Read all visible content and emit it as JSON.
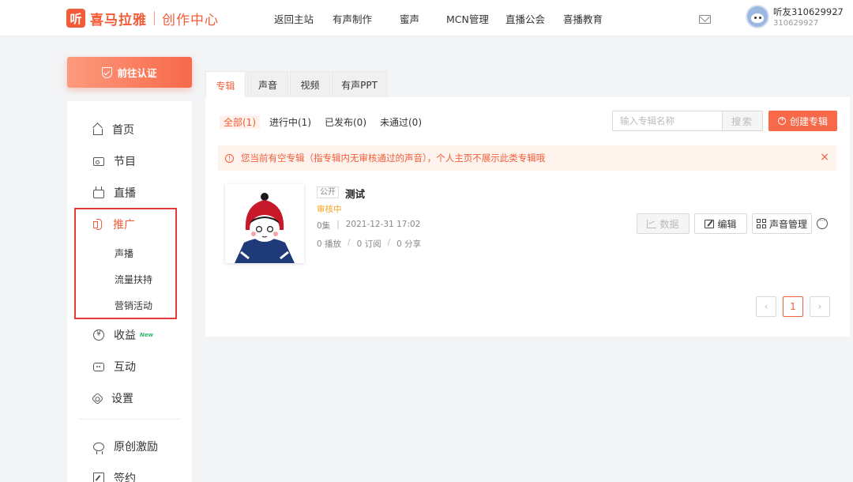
{
  "header": {
    "logo_mark": "听",
    "logo_name": "喜马拉雅",
    "logo_sub": "创作中心",
    "nav": [
      "返回主站",
      "有声制作",
      "蜜声",
      "MCN管理",
      "直播公会",
      "喜播教育"
    ],
    "user_name": "听友310629927",
    "user_id": "310629927"
  },
  "sidebar": {
    "certify_label": "前往认证",
    "items": [
      {
        "label": "首页",
        "icon": "home-icon"
      },
      {
        "label": "节目",
        "icon": "radio-icon"
      },
      {
        "label": "直播",
        "icon": "tv-icon"
      },
      {
        "label": "推广",
        "icon": "speaker-icon"
      },
      {
        "label": "收益",
        "icon": "coin-icon",
        "badge": "New"
      },
      {
        "label": "互动",
        "icon": "chat-icon"
      },
      {
        "label": "设置",
        "icon": "gear-icon"
      },
      {
        "label": "原创激励",
        "icon": "medal-icon"
      },
      {
        "label": "签约",
        "icon": "sign-icon"
      }
    ],
    "promo_sub": [
      "声播",
      "流量扶持",
      "营销活动"
    ],
    "active_color": "#f25c38",
    "highlight_color": "#e63b3b"
  },
  "tabs": [
    "专辑",
    "声音",
    "视频",
    "有声PPT"
  ],
  "filters": [
    "全部(1)",
    "进行中(1)",
    "已发布(0)",
    "未通过(0)"
  ],
  "search": {
    "placeholder": "输入专辑名称",
    "button": "搜索"
  },
  "create_label": "创建专辑",
  "notice": {
    "text": "您当前有空专辑（指专辑内无审核通过的声音），个人主页不展示此类专辑哦",
    "close": "×"
  },
  "album": {
    "tag": "公开",
    "title": "测试",
    "status": "审核中",
    "episodes": "0集",
    "date": "2021-12-31 17:02",
    "plays": "0 播放",
    "subs": "0 订阅",
    "shares": "0 分享",
    "actions": [
      "数据",
      "编辑",
      "声音管理"
    ]
  },
  "pager": {
    "prev": "‹",
    "current": "1",
    "next": "›"
  },
  "accent": "#f8694a"
}
